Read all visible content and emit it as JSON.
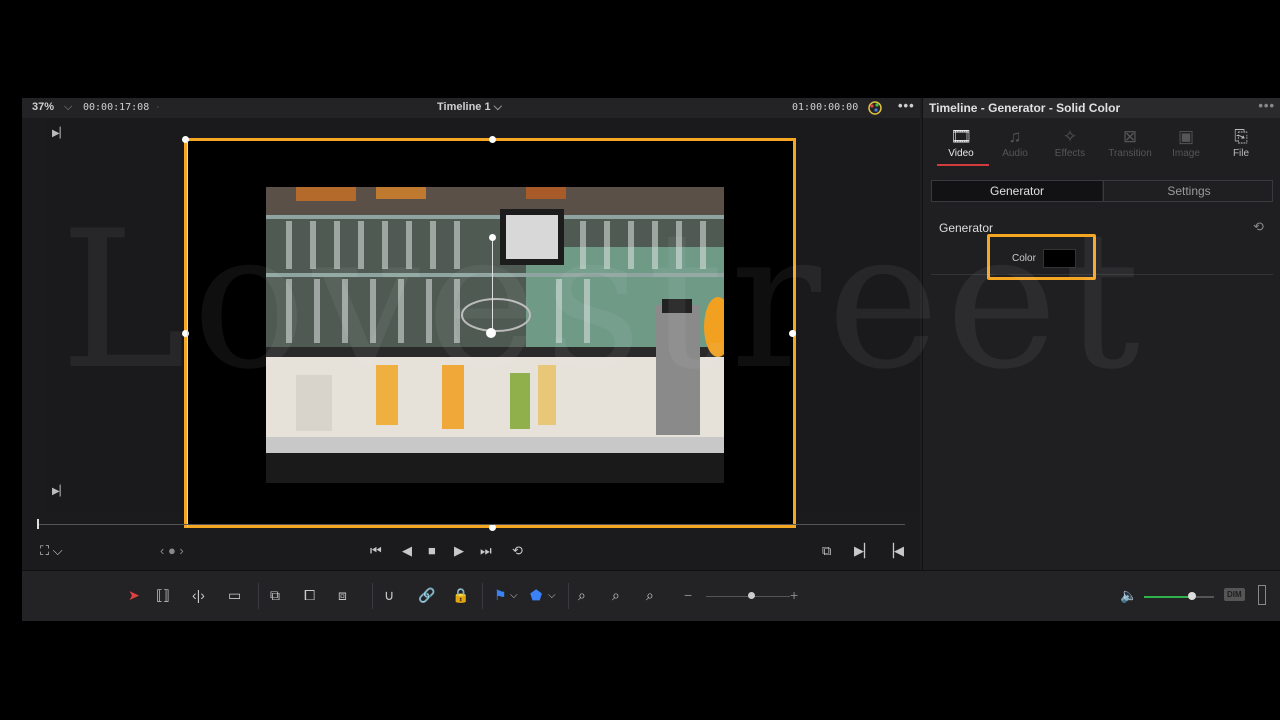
{
  "viewer": {
    "zoom": "37%",
    "timecode_left": "00:00:17:08",
    "timeline_title": "Timeline 1",
    "timecode_right": "01:00:00:00",
    "more": "•••"
  },
  "inspector": {
    "title": "Timeline - Generator - Solid Color",
    "more": "•••",
    "tabs": [
      {
        "label": "Video",
        "icon": "film-icon"
      },
      {
        "label": "Audio",
        "icon": "music-note-icon"
      },
      {
        "label": "Effects",
        "icon": "magic-wand-icon"
      },
      {
        "label": "Transition",
        "icon": "transition-icon"
      },
      {
        "label": "Image",
        "icon": "image-icon"
      },
      {
        "label": "File",
        "icon": "file-icon"
      }
    ],
    "subtabs": {
      "generator": "Generator",
      "settings": "Settings"
    },
    "section_title": "Generator",
    "color_label": "Color",
    "swatch_color": "#000000"
  },
  "toolbar": {
    "dim_label": "DIM"
  },
  "colors": {
    "highlight": "#f5a623",
    "active_tab_underline": "#d23b3b",
    "volume": "#2fb34a"
  },
  "watermark": "Lovestreet"
}
